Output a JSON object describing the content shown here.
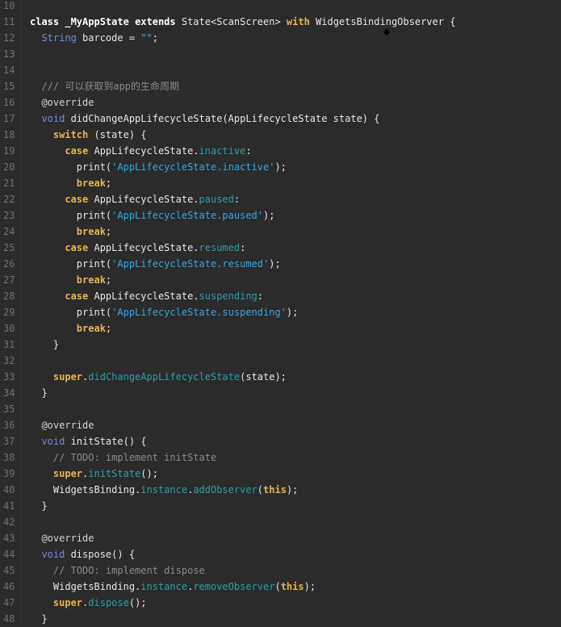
{
  "editor": {
    "line_numbers": [
      "10",
      "11",
      "12",
      "13",
      "14",
      "15",
      "16",
      "17",
      "18",
      "19",
      "20",
      "21",
      "22",
      "23",
      "24",
      "25",
      "26",
      "27",
      "28",
      "29",
      "30",
      "31",
      "32",
      "33",
      "34",
      "35",
      "36",
      "37",
      "38",
      "39",
      "40",
      "41",
      "42",
      "43",
      "44",
      "45",
      "46",
      "47",
      "48"
    ],
    "lines": [
      [],
      [
        [
          "kw-plain",
          "class "
        ],
        [
          "kw-plain",
          "_MyAppState "
        ],
        [
          "kw-plain",
          "extends "
        ],
        [
          "",
          "State<ScanScreen> "
        ],
        [
          "kw",
          "with "
        ],
        [
          "",
          "WidgetsBindingObserver {"
        ]
      ],
      [
        [
          "",
          "  "
        ],
        [
          "type",
          "String "
        ],
        [
          "",
          "barcode = "
        ],
        [
          "str",
          "\"\""
        ],
        [
          "",
          ";"
        ]
      ],
      [],
      [],
      [
        [
          "",
          "  "
        ],
        [
          "comment",
          "/// 可以获取到app的生命周期"
        ]
      ],
      [
        [
          "",
          "  "
        ],
        [
          "ann",
          "@override"
        ]
      ],
      [
        [
          "",
          "  "
        ],
        [
          "type",
          "void "
        ],
        [
          "",
          "didChangeAppLifecycleState(AppLifecycleState state) {"
        ]
      ],
      [
        [
          "",
          "    "
        ],
        [
          "kw",
          "switch "
        ],
        [
          "",
          "(state) {"
        ]
      ],
      [
        [
          "",
          "      "
        ],
        [
          "kw",
          "case "
        ],
        [
          "",
          "AppLifecycleState."
        ],
        [
          "field",
          "inactive"
        ],
        [
          "",
          ":"
        ]
      ],
      [
        [
          "",
          "        "
        ],
        [
          "",
          "print("
        ],
        [
          "str",
          "'AppLifecycleState.inactive'"
        ],
        [
          "",
          ");"
        ]
      ],
      [
        [
          "",
          "        "
        ],
        [
          "kw",
          "break"
        ],
        [
          "",
          ";"
        ]
      ],
      [
        [
          "",
          "      "
        ],
        [
          "kw",
          "case "
        ],
        [
          "",
          "AppLifecycleState."
        ],
        [
          "field",
          "paused"
        ],
        [
          "",
          ":"
        ]
      ],
      [
        [
          "",
          "        "
        ],
        [
          "",
          "print("
        ],
        [
          "str",
          "'AppLifecycleState.paused'"
        ],
        [
          "",
          ");"
        ]
      ],
      [
        [
          "",
          "        "
        ],
        [
          "kw",
          "break"
        ],
        [
          "",
          ";"
        ]
      ],
      [
        [
          "",
          "      "
        ],
        [
          "kw",
          "case "
        ],
        [
          "",
          "AppLifecycleState."
        ],
        [
          "field",
          "resumed"
        ],
        [
          "",
          ":"
        ]
      ],
      [
        [
          "",
          "        "
        ],
        [
          "",
          "print("
        ],
        [
          "str",
          "'AppLifecycleState.resumed'"
        ],
        [
          "",
          ");"
        ]
      ],
      [
        [
          "",
          "        "
        ],
        [
          "kw",
          "break"
        ],
        [
          "",
          ";"
        ]
      ],
      [
        [
          "",
          "      "
        ],
        [
          "kw",
          "case "
        ],
        [
          "",
          "AppLifecycleState."
        ],
        [
          "field",
          "suspending"
        ],
        [
          "",
          ":"
        ]
      ],
      [
        [
          "",
          "        "
        ],
        [
          "",
          "print("
        ],
        [
          "str",
          "'AppLifecycleState.suspending'"
        ],
        [
          "",
          ");"
        ]
      ],
      [
        [
          "",
          "        "
        ],
        [
          "kw",
          "break"
        ],
        [
          "",
          ";"
        ]
      ],
      [
        [
          "",
          "    "
        ],
        [
          "",
          "}"
        ]
      ],
      [],
      [
        [
          "",
          "    "
        ],
        [
          "kw",
          "super"
        ],
        [
          "",
          "."
        ],
        [
          "field",
          "didChangeAppLifecycleState"
        ],
        [
          "",
          "(state);"
        ]
      ],
      [
        [
          "",
          "  "
        ],
        [
          "",
          "}"
        ]
      ],
      [],
      [
        [
          "",
          "  "
        ],
        [
          "ann",
          "@override"
        ]
      ],
      [
        [
          "",
          "  "
        ],
        [
          "type",
          "void "
        ],
        [
          "",
          "initState() {"
        ]
      ],
      [
        [
          "",
          "    "
        ],
        [
          "comment",
          "// TODO: implement initState"
        ]
      ],
      [
        [
          "",
          "    "
        ],
        [
          "kw",
          "super"
        ],
        [
          "",
          "."
        ],
        [
          "field",
          "initState"
        ],
        [
          "",
          "();"
        ]
      ],
      [
        [
          "",
          "    "
        ],
        [
          "",
          "WidgetsBinding."
        ],
        [
          "field",
          "instance"
        ],
        [
          "",
          "."
        ],
        [
          "field",
          "addObserver"
        ],
        [
          "",
          "("
        ],
        [
          "kw",
          "this"
        ],
        [
          "",
          ");"
        ]
      ],
      [
        [
          "",
          "  "
        ],
        [
          "",
          "}"
        ]
      ],
      [],
      [
        [
          "",
          "  "
        ],
        [
          "ann",
          "@override"
        ]
      ],
      [
        [
          "",
          "  "
        ],
        [
          "type",
          "void "
        ],
        [
          "",
          "dispose() {"
        ]
      ],
      [
        [
          "",
          "    "
        ],
        [
          "comment",
          "// TODO: implement dispose"
        ]
      ],
      [
        [
          "",
          "    "
        ],
        [
          "",
          "WidgetsBinding."
        ],
        [
          "field",
          "instance"
        ],
        [
          "",
          "."
        ],
        [
          "field",
          "removeObserver"
        ],
        [
          "",
          "("
        ],
        [
          "kw",
          "this"
        ],
        [
          "",
          ");"
        ]
      ],
      [
        [
          "",
          "    "
        ],
        [
          "kw",
          "super"
        ],
        [
          "",
          "."
        ],
        [
          "field",
          "dispose"
        ],
        [
          "",
          "();"
        ]
      ],
      [
        [
          "",
          "  "
        ],
        [
          "",
          "}"
        ]
      ]
    ]
  }
}
